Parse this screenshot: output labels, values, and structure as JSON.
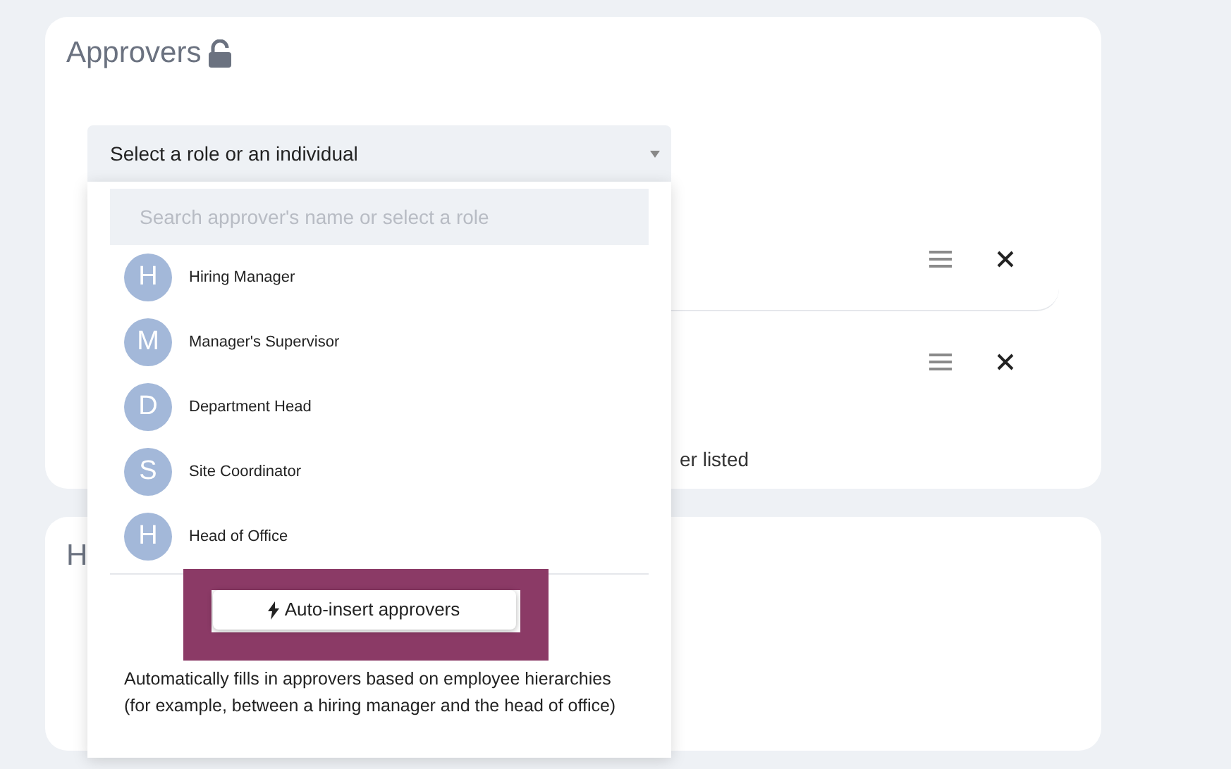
{
  "approvers_card": {
    "title": "Approvers",
    "locked": false,
    "approver_rows": [
      {
        "bordered": true
      },
      {
        "bordered": false
      }
    ],
    "footer_text": "er listed"
  },
  "second_card": {
    "title": "H"
  },
  "dropdown": {
    "value": "Select a role or an individual",
    "search": {
      "placeholder": "Search approver's name or select a role"
    },
    "options": [
      {
        "initial": "H",
        "label": "Hiring Manager"
      },
      {
        "initial": "M",
        "label": "Manager's Supervisor"
      },
      {
        "initial": "D",
        "label": "Department Head"
      },
      {
        "initial": "S",
        "label": "Site Coordinator"
      },
      {
        "initial": "H",
        "label": "Head of Office"
      }
    ],
    "auto_insert": {
      "label": "Auto-insert approvers",
      "highlighted": true
    },
    "description": "Automatically fills in approvers based on employee hierarchies (for example, between a hiring manager and the head of office)"
  }
}
